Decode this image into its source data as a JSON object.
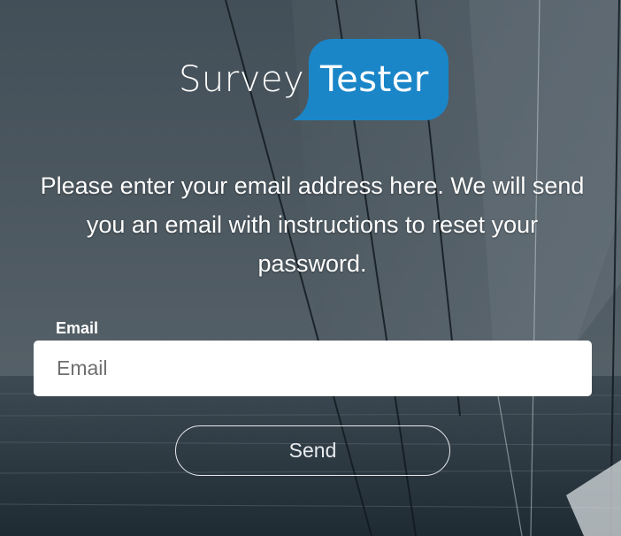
{
  "logo": {
    "word1": "Survey",
    "word2": "Tester",
    "bubble_color": "#1a86c8"
  },
  "instructions": "Please enter your email address here. We will send you an email with instructions to reset your password.",
  "form": {
    "email_label": "Email",
    "email_placeholder": "Email",
    "email_value": "",
    "send_label": "Send"
  },
  "colors": {
    "sea": "#27333c",
    "sky": "#56626a"
  }
}
